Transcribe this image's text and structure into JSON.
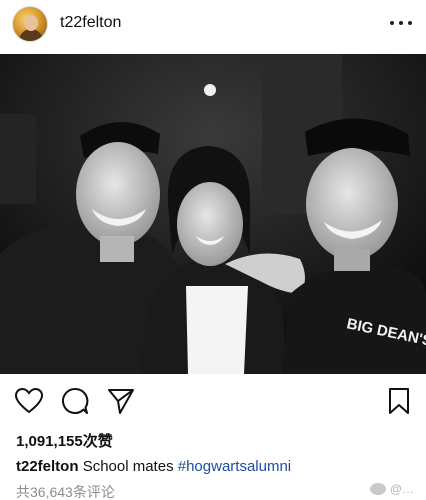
{
  "post": {
    "username": "t22felton",
    "likes": "1,091,155次赞",
    "caption_user": "t22felton",
    "caption_text": "School mates",
    "hashtag": "#hogwartsalumni",
    "comments": "共36,643条评论",
    "photo_text": "BIG DEAN'S"
  },
  "watermark": {
    "text": "@…"
  },
  "icons": {
    "more": "more-options-icon",
    "like": "heart-icon",
    "comment": "comment-icon",
    "share": "send-icon",
    "save": "bookmark-icon"
  },
  "colors": {
    "hashtag": "#1b4f9c",
    "muted": "#8e8e8e"
  }
}
